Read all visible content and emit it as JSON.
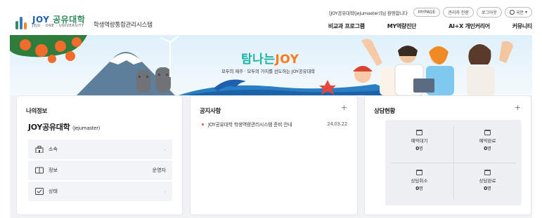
{
  "header": {
    "logo": {
      "main_en": "JOY",
      "main_ko": "공유대학",
      "sub": "JEJU · ONE · UNIVERSITY"
    },
    "system_name": "학생역량통합관리시스템",
    "welcome": "[JOY공유대학(jejumaster)]님 환영합니다",
    "util_buttons": [
      "MYPAGE",
      "관리자 전환",
      "로그아웃"
    ],
    "language": "국문",
    "nav": [
      "비교과 프로그램",
      "MY역량진단",
      "AI+X 개인커리어",
      "커뮤니티"
    ]
  },
  "banner": {
    "title_ko": "탐나는",
    "title_en": "JOY",
    "subtitle": "모두의 제주 · 모두의 가치를 선도하는 JOY공유대학"
  },
  "my_info": {
    "title": "나의정보",
    "name": "JOY공유대학",
    "user_id": "(jejumaster)",
    "rows": [
      {
        "icon": "building-icon",
        "label": "소속",
        "value": "-"
      },
      {
        "icon": "id-card-icon",
        "label": "정보",
        "value": "운영자"
      },
      {
        "icon": "status-icon",
        "label": "상태",
        "value": "-"
      }
    ]
  },
  "notice": {
    "title": "공지사항",
    "items": [
      {
        "text": "JOY공유대학 학생역량관리시스템 준비 안내",
        "date": "24.03.22"
      }
    ]
  },
  "consult": {
    "title": "상담현황",
    "cells": [
      {
        "label": "예약대기",
        "count": "0",
        "unit": "명"
      },
      {
        "label": "예약완료",
        "count": "0",
        "unit": "명"
      },
      {
        "label": "상담취소",
        "count": "0",
        "unit": "명"
      },
      {
        "label": "상담완료",
        "count": "0",
        "unit": "명"
      }
    ]
  },
  "colors": {
    "brand_blue": "#1f5fae",
    "brand_green": "#2d8c5a",
    "banner_teal": "#1fb3a6",
    "banner_orange": "#ff7a1c",
    "notice_dot": "#e94b4b"
  }
}
